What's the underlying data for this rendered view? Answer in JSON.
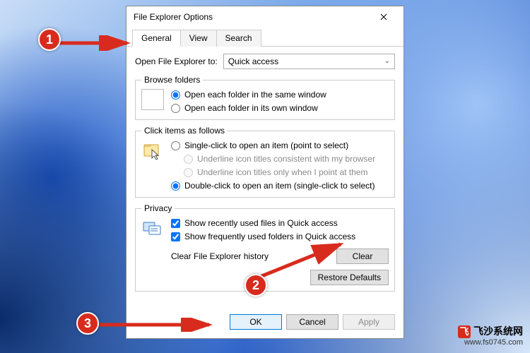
{
  "dialog": {
    "title": "File Explorer Options",
    "tabs": [
      "General",
      "View",
      "Search"
    ],
    "active_tab": 0,
    "open_to_label": "Open File Explorer to:",
    "open_to_value": "Quick access",
    "browse": {
      "legend": "Browse folders",
      "same": "Open each folder in the same window",
      "own": "Open each folder in its own window"
    },
    "click": {
      "legend": "Click items as follows",
      "single": "Single-click to open an item (point to select)",
      "under_browser": "Underline icon titles consistent with my browser",
      "under_point": "Underline icon titles only when I point at them",
      "double": "Double-click to open an item (single-click to select)"
    },
    "privacy": {
      "legend": "Privacy",
      "recent": "Show recently used files in Quick access",
      "frequent": "Show frequently used folders in Quick access",
      "clear_label": "Clear File Explorer history",
      "clear_btn": "Clear",
      "restore_btn": "Restore Defaults"
    },
    "footer": {
      "ok": "OK",
      "cancel": "Cancel",
      "apply": "Apply"
    }
  },
  "callouts": {
    "c1": "1",
    "c2": "2",
    "c3": "3"
  },
  "watermark": {
    "brand": "飞沙系统网",
    "url": "www.fs0745.com"
  }
}
